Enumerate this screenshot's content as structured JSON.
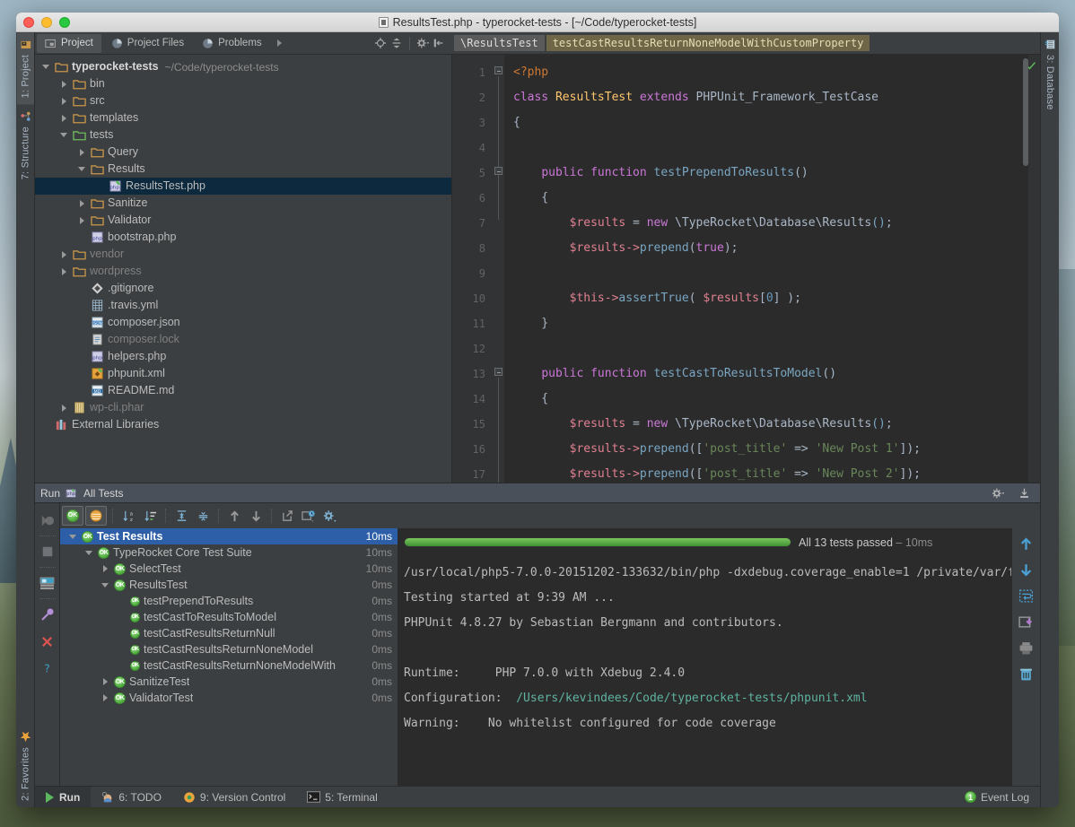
{
  "window": {
    "title": "ResultsTest.php - typerocket-tests - [~/Code/typerocket-tests]",
    "title_icon": "php-file-icon"
  },
  "left_sidebar": {
    "top": [
      {
        "label": "1: Project",
        "icon": "project-icon",
        "selected": true
      },
      {
        "label": "7: Structure",
        "icon": "structure-icon",
        "selected": false
      }
    ],
    "bottom": [
      {
        "label": "2: Favorites",
        "icon": "star-icon",
        "selected": false
      }
    ]
  },
  "right_sidebar": {
    "items": [
      {
        "label": "3: Database",
        "icon": "database-icon",
        "selected": false
      }
    ]
  },
  "project_toolbar": {
    "tabs": [
      {
        "label": "Project",
        "icon": "project-module-icon",
        "active": true
      },
      {
        "label": "Project Files",
        "icon": "pie-chart-icon",
        "active": false
      },
      {
        "label": "Problems",
        "icon": "pie-chart-icon",
        "active": false
      }
    ],
    "overflow_icon": "chevron-right-icon",
    "actions": [
      {
        "name": "locate-icon"
      },
      {
        "name": "collapse-all-icon"
      },
      {
        "name": "gear-dropdown-icon"
      },
      {
        "name": "hide-panel-icon"
      }
    ]
  },
  "breadcrumb": {
    "class": "\\ResultsTest",
    "method": "testCastResultsReturnNoneModelWithCustomProperty"
  },
  "project_tree": [
    {
      "indent": 0,
      "arrow": "open",
      "icon": "folder-orange",
      "label": "typerocket-tests",
      "bold": true,
      "path": "~/Code/typerocket-tests",
      "dim": false,
      "selected": false
    },
    {
      "indent": 1,
      "arrow": "closed",
      "icon": "folder-orange",
      "label": "bin",
      "bold": false,
      "path": "",
      "dim": false,
      "selected": false
    },
    {
      "indent": 1,
      "arrow": "closed",
      "icon": "folder-orange",
      "label": "src",
      "bold": false,
      "path": "",
      "dim": false,
      "selected": false
    },
    {
      "indent": 1,
      "arrow": "closed",
      "icon": "folder-orange",
      "label": "templates",
      "bold": false,
      "path": "",
      "dim": false,
      "selected": false
    },
    {
      "indent": 1,
      "arrow": "open",
      "icon": "folder-green",
      "label": "tests",
      "bold": false,
      "path": "",
      "dim": false,
      "selected": false
    },
    {
      "indent": 2,
      "arrow": "closed",
      "icon": "folder-orange",
      "label": "Query",
      "bold": false,
      "path": "",
      "dim": false,
      "selected": false
    },
    {
      "indent": 2,
      "arrow": "open",
      "icon": "folder-orange",
      "label": "Results",
      "bold": false,
      "path": "",
      "dim": false,
      "selected": false
    },
    {
      "indent": 3,
      "arrow": "none",
      "icon": "php-test-file",
      "label": "ResultsTest.php",
      "bold": false,
      "path": "",
      "dim": false,
      "selected": true
    },
    {
      "indent": 2,
      "arrow": "closed",
      "icon": "folder-orange",
      "label": "Sanitize",
      "bold": false,
      "path": "",
      "dim": false,
      "selected": false
    },
    {
      "indent": 2,
      "arrow": "closed",
      "icon": "folder-orange",
      "label": "Validator",
      "bold": false,
      "path": "",
      "dim": false,
      "selected": false
    },
    {
      "indent": 2,
      "arrow": "none",
      "icon": "php-file",
      "label": "bootstrap.php",
      "bold": false,
      "path": "",
      "dim": false,
      "selected": false
    },
    {
      "indent": 1,
      "arrow": "closed",
      "icon": "folder-orange",
      "label": "vendor",
      "bold": false,
      "path": "",
      "dim": true,
      "selected": false
    },
    {
      "indent": 1,
      "arrow": "closed",
      "icon": "folder-orange",
      "label": "wordpress",
      "bold": false,
      "path": "",
      "dim": true,
      "selected": false
    },
    {
      "indent": 2,
      "arrow": "none",
      "icon": "git-icon",
      "label": ".gitignore",
      "bold": false,
      "path": "",
      "dim": false,
      "selected": false
    },
    {
      "indent": 2,
      "arrow": "none",
      "icon": "yml-icon",
      "label": ".travis.yml",
      "bold": false,
      "path": "",
      "dim": false,
      "selected": false
    },
    {
      "indent": 2,
      "arrow": "none",
      "icon": "json-icon",
      "label": "composer.json",
      "bold": false,
      "path": "",
      "dim": false,
      "selected": false
    },
    {
      "indent": 2,
      "arrow": "none",
      "icon": "lock-file-icon",
      "label": "composer.lock",
      "bold": false,
      "path": "",
      "dim": true,
      "selected": false
    },
    {
      "indent": 2,
      "arrow": "none",
      "icon": "php-file",
      "label": "helpers.php",
      "bold": false,
      "path": "",
      "dim": false,
      "selected": false
    },
    {
      "indent": 2,
      "arrow": "none",
      "icon": "phpunit-xml-icon",
      "label": "phpunit.xml",
      "bold": false,
      "path": "",
      "dim": false,
      "selected": false
    },
    {
      "indent": 2,
      "arrow": "none",
      "icon": "markdown-icon",
      "label": "README.md",
      "bold": false,
      "path": "",
      "dim": false,
      "selected": false
    },
    {
      "indent": 1,
      "arrow": "closed",
      "icon": "phar-icon",
      "label": "wp-cli.phar",
      "bold": false,
      "path": "",
      "dim": true,
      "selected": false
    },
    {
      "indent": 0,
      "arrow": "none",
      "icon": "external-libraries-icon",
      "label": "External Libraries",
      "bold": false,
      "path": "",
      "dim": false,
      "selected": false
    }
  ],
  "editor": {
    "first_line": 1,
    "lines": [
      {
        "n": 1,
        "tokens": [
          {
            "t": "<?php",
            "c": "k"
          }
        ]
      },
      {
        "n": 2,
        "tokens": [
          {
            "t": "class ",
            "c": "kw"
          },
          {
            "t": "ResultsTest ",
            "c": "cls"
          },
          {
            "t": "extends ",
            "c": "kw"
          },
          {
            "t": "PHPUnit_Framework_TestCase",
            "c": "pl"
          }
        ]
      },
      {
        "n": 3,
        "tokens": [
          {
            "t": "{",
            "c": "pl"
          }
        ]
      },
      {
        "n": 4,
        "tokens": [
          {
            "t": "",
            "c": "pl"
          }
        ]
      },
      {
        "n": 5,
        "tokens": [
          {
            "t": "    ",
            "c": "pl"
          },
          {
            "t": "public function ",
            "c": "kw"
          },
          {
            "t": "testPrependToResults",
            "c": "fn"
          },
          {
            "t": "()",
            "c": "pl"
          }
        ]
      },
      {
        "n": 6,
        "tokens": [
          {
            "t": "    {",
            "c": "pl"
          }
        ]
      },
      {
        "n": 7,
        "tokens": [
          {
            "t": "        ",
            "c": "pl"
          },
          {
            "t": "$results ",
            "c": "var"
          },
          {
            "t": "= ",
            "c": "pl"
          },
          {
            "t": "new ",
            "c": "kw"
          },
          {
            "t": "\\TypeRocket\\Database\\Results",
            "c": "pl"
          },
          {
            "t": "()",
            "c": "fn"
          },
          {
            "t": ";",
            "c": "pl"
          }
        ]
      },
      {
        "n": 8,
        "tokens": [
          {
            "t": "        ",
            "c": "pl"
          },
          {
            "t": "$results",
            "c": "var"
          },
          {
            "t": "->",
            "c": "var"
          },
          {
            "t": "prepend",
            "c": "fn"
          },
          {
            "t": "(",
            "c": "pl"
          },
          {
            "t": "true",
            "c": "kw"
          },
          {
            "t": ");",
            "c": "pl"
          }
        ]
      },
      {
        "n": 9,
        "tokens": [
          {
            "t": "",
            "c": "pl"
          }
        ]
      },
      {
        "n": 10,
        "tokens": [
          {
            "t": "        ",
            "c": "pl"
          },
          {
            "t": "$this",
            "c": "var"
          },
          {
            "t": "->",
            "c": "var"
          },
          {
            "t": "assertTrue",
            "c": "fn"
          },
          {
            "t": "( ",
            "c": "pl"
          },
          {
            "t": "$results",
            "c": "var"
          },
          {
            "t": "[",
            "c": "pl"
          },
          {
            "t": "0",
            "c": "num"
          },
          {
            "t": "] );",
            "c": "pl"
          }
        ]
      },
      {
        "n": 11,
        "tokens": [
          {
            "t": "    }",
            "c": "pl"
          }
        ]
      },
      {
        "n": 12,
        "tokens": [
          {
            "t": "",
            "c": "pl"
          }
        ]
      },
      {
        "n": 13,
        "tokens": [
          {
            "t": "    ",
            "c": "pl"
          },
          {
            "t": "public function ",
            "c": "kw"
          },
          {
            "t": "testCastToResultsToModel",
            "c": "fn"
          },
          {
            "t": "()",
            "c": "pl"
          }
        ]
      },
      {
        "n": 14,
        "tokens": [
          {
            "t": "    {",
            "c": "pl"
          }
        ]
      },
      {
        "n": 15,
        "tokens": [
          {
            "t": "        ",
            "c": "pl"
          },
          {
            "t": "$results ",
            "c": "var"
          },
          {
            "t": "= ",
            "c": "pl"
          },
          {
            "t": "new ",
            "c": "kw"
          },
          {
            "t": "\\TypeRocket\\Database\\Results",
            "c": "pl"
          },
          {
            "t": "()",
            "c": "fn"
          },
          {
            "t": ";",
            "c": "pl"
          }
        ]
      },
      {
        "n": 16,
        "tokens": [
          {
            "t": "        ",
            "c": "pl"
          },
          {
            "t": "$results",
            "c": "var"
          },
          {
            "t": "->",
            "c": "var"
          },
          {
            "t": "prepend",
            "c": "fn"
          },
          {
            "t": "([",
            "c": "pl"
          },
          {
            "t": "'post_title'",
            "c": "str"
          },
          {
            "t": " => ",
            "c": "pl"
          },
          {
            "t": "'New Post 1'",
            "c": "str"
          },
          {
            "t": "]);",
            "c": "pl"
          }
        ]
      },
      {
        "n": 17,
        "tokens": [
          {
            "t": "        ",
            "c": "pl"
          },
          {
            "t": "$results",
            "c": "var"
          },
          {
            "t": "->",
            "c": "var"
          },
          {
            "t": "prepend",
            "c": "fn"
          },
          {
            "t": "([",
            "c": "pl"
          },
          {
            "t": "'post_title'",
            "c": "str"
          },
          {
            "t": " => ",
            "c": "pl"
          },
          {
            "t": "'New Post 2'",
            "c": "str"
          },
          {
            "t": "]);",
            "c": "pl"
          }
        ]
      }
    ],
    "inspection_status": "ok-check-icon"
  },
  "run_panel": {
    "header": {
      "label": "Run",
      "icon": "phpunit-icon",
      "config": "All Tests"
    },
    "header_actions": [
      {
        "name": "settings-gear-icon"
      },
      {
        "name": "hide-panel-icon"
      }
    ],
    "left_rail": [
      {
        "name": "rerun-icon"
      },
      {
        "name": "stop-icon"
      },
      {
        "name": "toggle-console-icon"
      },
      {
        "name": "pin-tab-icon"
      },
      {
        "name": "close-icon"
      },
      {
        "name": "help-icon"
      }
    ],
    "toolbar": [
      {
        "name": "show-passed-toggle",
        "pressed": true
      },
      {
        "name": "show-ignored-toggle",
        "pressed": true
      },
      {
        "name": "sort-alphabetically-icon"
      },
      {
        "name": "sort-by-duration-icon"
      },
      {
        "name": "expand-all-icon"
      },
      {
        "name": "collapse-all-icon"
      },
      {
        "name": "previous-failed-icon"
      },
      {
        "name": "next-failed-icon"
      },
      {
        "name": "export-test-results-icon"
      },
      {
        "name": "test-history-icon"
      },
      {
        "name": "test-settings-icon"
      }
    ],
    "progress": {
      "percent": 100,
      "text": "All 13 tests passed",
      "duration": "10ms"
    },
    "tests": [
      {
        "indent": 0,
        "arrow": "open",
        "label": "Test Results",
        "duration": "10ms",
        "selected": true
      },
      {
        "indent": 1,
        "arrow": "open",
        "label": "TypeRocket Core Test Suite",
        "duration": "10ms",
        "selected": false
      },
      {
        "indent": 2,
        "arrow": "closed",
        "label": "SelectTest",
        "duration": "10ms",
        "selected": false
      },
      {
        "indent": 2,
        "arrow": "open",
        "label": "ResultsTest",
        "duration": "0ms",
        "selected": false
      },
      {
        "indent": 3,
        "arrow": "none",
        "label": "testPrependToResults",
        "duration": "0ms",
        "selected": false
      },
      {
        "indent": 3,
        "arrow": "none",
        "label": "testCastToResultsToModel",
        "duration": "0ms",
        "selected": false
      },
      {
        "indent": 3,
        "arrow": "none",
        "label": "testCastResultsReturnNull",
        "duration": "0ms",
        "selected": false
      },
      {
        "indent": 3,
        "arrow": "none",
        "label": "testCastResultsReturnNoneModel",
        "duration": "0ms",
        "selected": false
      },
      {
        "indent": 3,
        "arrow": "none",
        "label": "testCastResultsReturnNoneModelWith",
        "duration": "0ms",
        "selected": false
      },
      {
        "indent": 2,
        "arrow": "closed",
        "label": "SanitizeTest",
        "duration": "0ms",
        "selected": false
      },
      {
        "indent": 2,
        "arrow": "closed",
        "label": "ValidatorTest",
        "duration": "0ms",
        "selected": false
      }
    ],
    "console": [
      {
        "text": "/usr/local/php5-7.0.0-20151202-133632/bin/php -dxdebug.coverage_enable=1 /private/var/f",
        "style": "plain"
      },
      {
        "text": "Testing started at 9:39 AM ...",
        "style": "plain"
      },
      {
        "text": "PHPUnit 4.8.27 by Sebastian Bergmann and contributors.",
        "style": "plain"
      },
      {
        "text": "",
        "style": "plain"
      },
      {
        "text": "Runtime:     PHP 7.0.0 with Xdebug 2.4.0",
        "style": "plain"
      },
      {
        "text": "Configuration:  /Users/kevindees/Code/typerocket-tests/phpunit.xml",
        "style": "path",
        "prefix": "Configuration:  "
      },
      {
        "text": "Warning:    No whitelist configured for code coverage",
        "style": "plain"
      }
    ],
    "console_rail": [
      {
        "name": "scroll-up-icon"
      },
      {
        "name": "scroll-down-icon"
      },
      {
        "name": "soft-wrap-icon"
      },
      {
        "name": "save-output-icon"
      },
      {
        "name": "print-icon"
      },
      {
        "name": "clear-all-icon"
      }
    ]
  },
  "status_bar": {
    "left": [
      {
        "label": "Run",
        "icon": "play-icon",
        "active": true
      },
      {
        "label": "6: TODO",
        "icon": "todo-icon",
        "underline": "6",
        "active": false
      },
      {
        "label": "9: Version Control",
        "icon": "vcs-icon",
        "underline": "9",
        "active": false
      },
      {
        "label": "5: Terminal",
        "icon": "terminal-icon",
        "underline": "5",
        "active": false
      }
    ],
    "right": {
      "label": "Event Log",
      "count": "1",
      "icon": "event-log-icon"
    }
  },
  "colors": {
    "panel_bg": "#3c3f41",
    "editor_bg": "#2b2b2b",
    "accent_selection": "#2d5fa8",
    "tree_selection": "#0d293e",
    "pass_green": "#4fae3f",
    "breadcrumb_method": "#6e6647"
  }
}
